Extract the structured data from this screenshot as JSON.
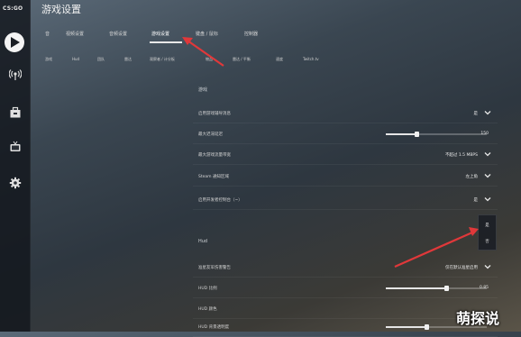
{
  "app": {
    "logo_text": "CS:GO",
    "title": "游戏设置"
  },
  "sidebar": {
    "icons": [
      "play-icon",
      "antenna-icon",
      "inventory-icon",
      "tv-icon",
      "gear-icon"
    ]
  },
  "tabs": [
    "音",
    "视频设置",
    "音频设置",
    "游戏设置",
    "键盘 / 鼠标",
    "控制器"
  ],
  "active_tab": "游戏设置",
  "subtabs": [
    "游戏",
    "Hud",
    "团队",
    "雷达",
    "观察者 / 计分板",
    "物品",
    "雷达 / 平衡",
    "速度",
    "Twitch.tv"
  ],
  "sections": {
    "game": {
      "title": "游戏",
      "rows": [
        {
          "label": "启用游戏辅导消息",
          "value": "是",
          "type": "dropdown"
        },
        {
          "label": "最大迟滞延迟",
          "value": "150",
          "type": "slider",
          "level": 0.3
        },
        {
          "label": "最大游戏流量带宽",
          "value": "不超过 1.5 MBPS",
          "type": "dropdown"
        },
        {
          "label": "Steam 通知区域",
          "value": "左上角",
          "type": "dropdown"
        },
        {
          "label": "启用开发者控制台（~）",
          "value": "是",
          "type": "dropdown"
        }
      ]
    },
    "hud": {
      "title": "Hud",
      "rows": [
        {
          "label": "准星友军伤害警告",
          "value": "仅在默认准星启用",
          "type": "dropdown"
        },
        {
          "label": "HUD 比例",
          "value": "0.85",
          "type": "slider",
          "level": 0.6
        },
        {
          "label": "HUD 颜色",
          "value": "",
          "type": "dropdown"
        },
        {
          "label": "HUD 背景透明度",
          "value": "",
          "type": "slider",
          "level": 0.4
        }
      ]
    }
  },
  "dropdown_menu": {
    "options": [
      "是",
      "否"
    ]
  },
  "watermark": {
    "text": "萌探说"
  },
  "colors": {
    "arrow": "#e0383a",
    "accent": "#ffffff"
  }
}
